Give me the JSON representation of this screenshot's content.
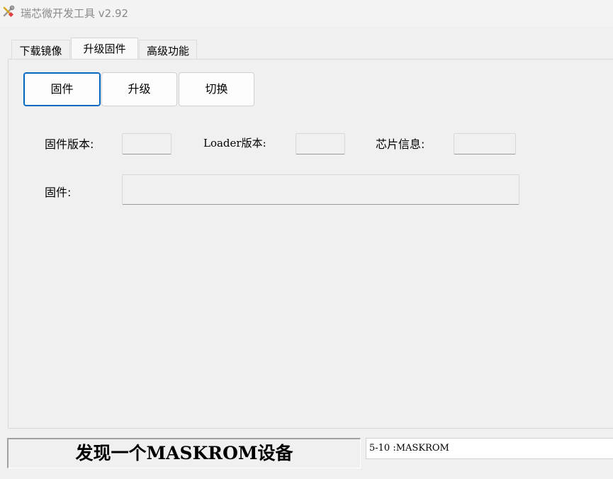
{
  "window": {
    "title": "瑞芯微开发工具 v2.92",
    "icon": "tools-icon"
  },
  "tabs": [
    {
      "label": "下载镜像",
      "active": false
    },
    {
      "label": "升级固件",
      "active": true
    },
    {
      "label": "高级功能",
      "active": false
    }
  ],
  "buttons": {
    "firmware": "固件",
    "upgrade": "升级",
    "switch": "切换"
  },
  "info": {
    "firmware_version_label": "固件版本:",
    "firmware_version_value": "",
    "loader_version_label": "Loader版本:",
    "loader_version_value": "",
    "chip_info_label": "芯片信息:",
    "chip_info_value": "",
    "firmware_path_label": "固件:",
    "firmware_path_value": ""
  },
  "status": {
    "message": "发现一个MASKROM设备",
    "log": "5-10 :MASKROM"
  },
  "colors": {
    "focus_border": "#0067c0",
    "title_text": "#8a8a8a"
  }
}
